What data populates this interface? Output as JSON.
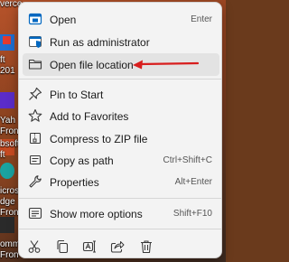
{
  "desktop": {
    "fragments": [
      "verce",
      "ft",
      "201",
      "Yah",
      "Fron",
      "bsoft",
      "ft",
      "icros",
      "dge",
      "Fron",
      "omm",
      "Fron"
    ]
  },
  "menu": {
    "items": [
      {
        "label": "Open",
        "shortcut": "Enter",
        "icon": "open-icon"
      },
      {
        "label": "Run as administrator",
        "shortcut": "",
        "icon": "shield-icon"
      },
      {
        "label": "Open file location",
        "shortcut": "",
        "icon": "folder-icon"
      },
      {
        "label": "Pin to Start",
        "shortcut": "",
        "icon": "pin-icon"
      },
      {
        "label": "Add to Favorites",
        "shortcut": "",
        "icon": "star-icon"
      },
      {
        "label": "Compress to ZIP file",
        "shortcut": "",
        "icon": "zip-icon"
      },
      {
        "label": "Copy as path",
        "shortcut": "Ctrl+Shift+C",
        "icon": "copy-path-icon"
      },
      {
        "label": "Properties",
        "shortcut": "Alt+Enter",
        "icon": "wrench-icon"
      },
      {
        "label": "Show more options",
        "shortcut": "Shift+F10",
        "icon": "more-options-icon"
      }
    ],
    "quick_actions": [
      "cut-icon",
      "copy-icon",
      "rename-icon",
      "share-icon",
      "delete-icon"
    ]
  },
  "colors": {
    "accent": "#0067c0",
    "annotation_arrow": "#d81e1e",
    "menu_bg": "#f3f3f3",
    "hover_bg": "#e3e3e3"
  }
}
